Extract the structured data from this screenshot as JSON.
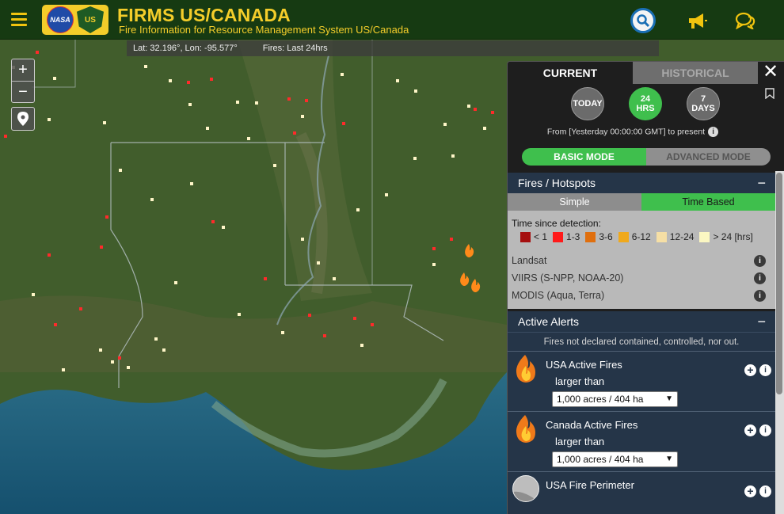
{
  "header": {
    "title": "FIRMS US/CANADA",
    "subtitle": "Fire Information for Resource Management System US/Canada",
    "logo_nasa": "NASA",
    "logo_usfs": "US"
  },
  "map": {
    "coords_text": "Lat: 32.196°, Lon: -95.577°",
    "fires_text": "Fires: Last 24hrs",
    "zoom_in": "+",
    "zoom_out": "−"
  },
  "panel": {
    "tab_current": "CURRENT",
    "tab_historical": "HISTORICAL",
    "close": "✕",
    "btn_today": "TODAY",
    "btn_24_num": "24",
    "btn_24_unit": "HRS",
    "btn_7_num": "7",
    "btn_7_unit": "DAYS",
    "from_text": "From [Yesterday 00:00:00 GMT] to present",
    "mode_basic": "BASIC MODE",
    "mode_advanced": "ADVANCED MODE",
    "fires_section": "Fires / Hotspots",
    "collapse": "−",
    "subtab_simple": "Simple",
    "subtab_timebased": "Time Based",
    "tsd_label": "Time since detection:",
    "legend": [
      {
        "label": "< 1",
        "color": "#a50f0f"
      },
      {
        "label": "1-3",
        "color": "#ff1a1a"
      },
      {
        "label": "3-6",
        "color": "#e06f0e"
      },
      {
        "label": "6-12",
        "color": "#f0a91c"
      },
      {
        "label": "12-24",
        "color": "#f6dfa5"
      },
      {
        "label": "> 24 [hrs]",
        "color": "#fbf7c2"
      }
    ],
    "sources": [
      "Landsat",
      "VIIRS (S-NPP, NOAA-20)",
      "MODIS (Aqua, Terra)"
    ],
    "alerts_section": "Active Alerts",
    "alerts_note": "Fires not declared contained, controlled, nor out.",
    "alerts": [
      {
        "name": "USA Active Fires",
        "larger": "larger than",
        "select": "1,000 acres / 404 ha"
      },
      {
        "name": "Canada Active Fires",
        "larger": "larger than",
        "select": "1,000 acres / 404 ha"
      }
    ],
    "perimeter_name": "USA Fire Perimeter",
    "info_glyph": "i",
    "plus_glyph": "+"
  }
}
